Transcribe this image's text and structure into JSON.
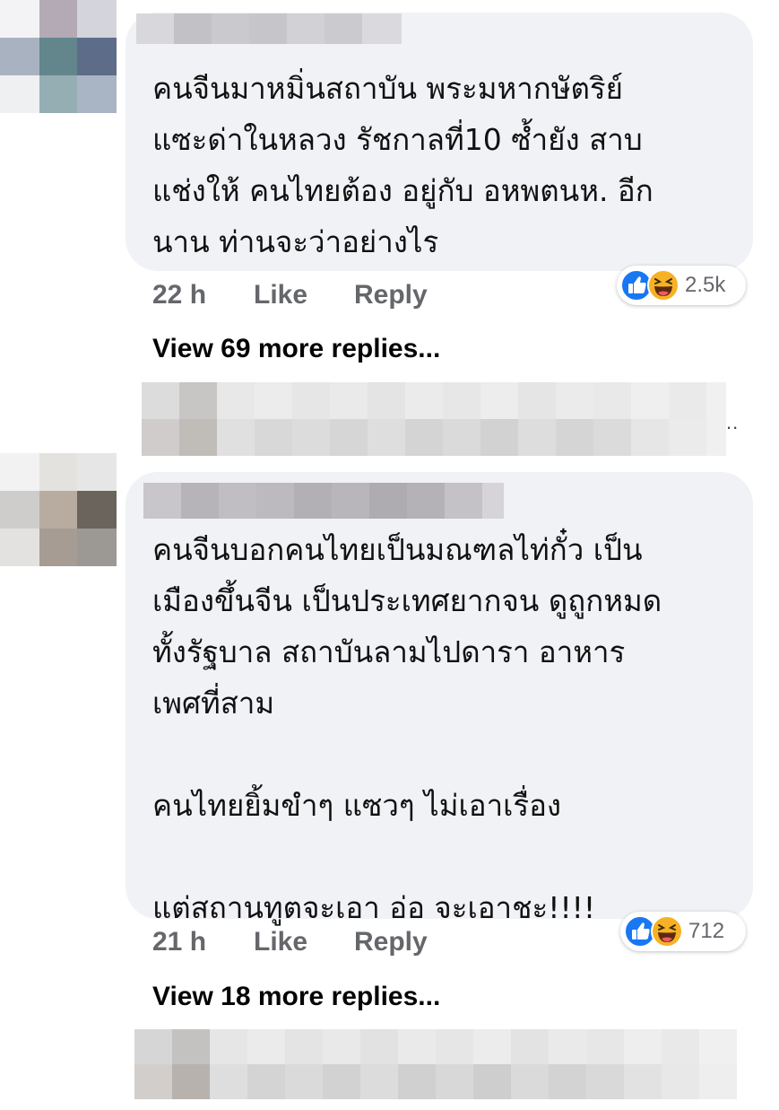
{
  "comments": [
    {
      "text": "คนจีนมาหมิ่นสถาบัน พระมหากษัตริย์\nแซะด่าในหลวง รัชกาลที่10  ซ้ำยัง สาบ\nแช่งให้ คนไทยต้อง อยู่กับ อหพตนห. อีก\nนาน ท่านจะว่าอย่างไร",
      "time": "22 h",
      "like_label": "Like",
      "reply_label": "Reply",
      "reaction_count": "2.5k",
      "view_more": "View 69 more replies..."
    },
    {
      "text": "คนจีนบอกคนไทยเป็นมณฑลไท่กั๋ว เป็น\nเมืองขึ้นจีน เป็นประเทศยากจน ดูถูกหมด\nทั้งรัฐบาล สถาบันลามไปดารา อาหาร\nเพศที่สาม\n\nคนไทยยิ้มขำๆ แซวๆ ไม่เอาเรื่อง\n\nแต่สถานทูตจะเอา อ่อ จะเอาชะ!!!!",
      "time": "21 h",
      "like_label": "Like",
      "reply_label": "Reply",
      "reaction_count": "712",
      "view_more": "View 18 more replies..."
    }
  ],
  "reply_preview": {
    "ellipsis": ".."
  },
  "reactions": [
    "like-icon",
    "haha-icon"
  ],
  "colors": {
    "bubble": "#f0f2f5",
    "meta_text": "#65676b",
    "like_blue": "#1877f2",
    "haha_yellow": "#f7b125"
  }
}
